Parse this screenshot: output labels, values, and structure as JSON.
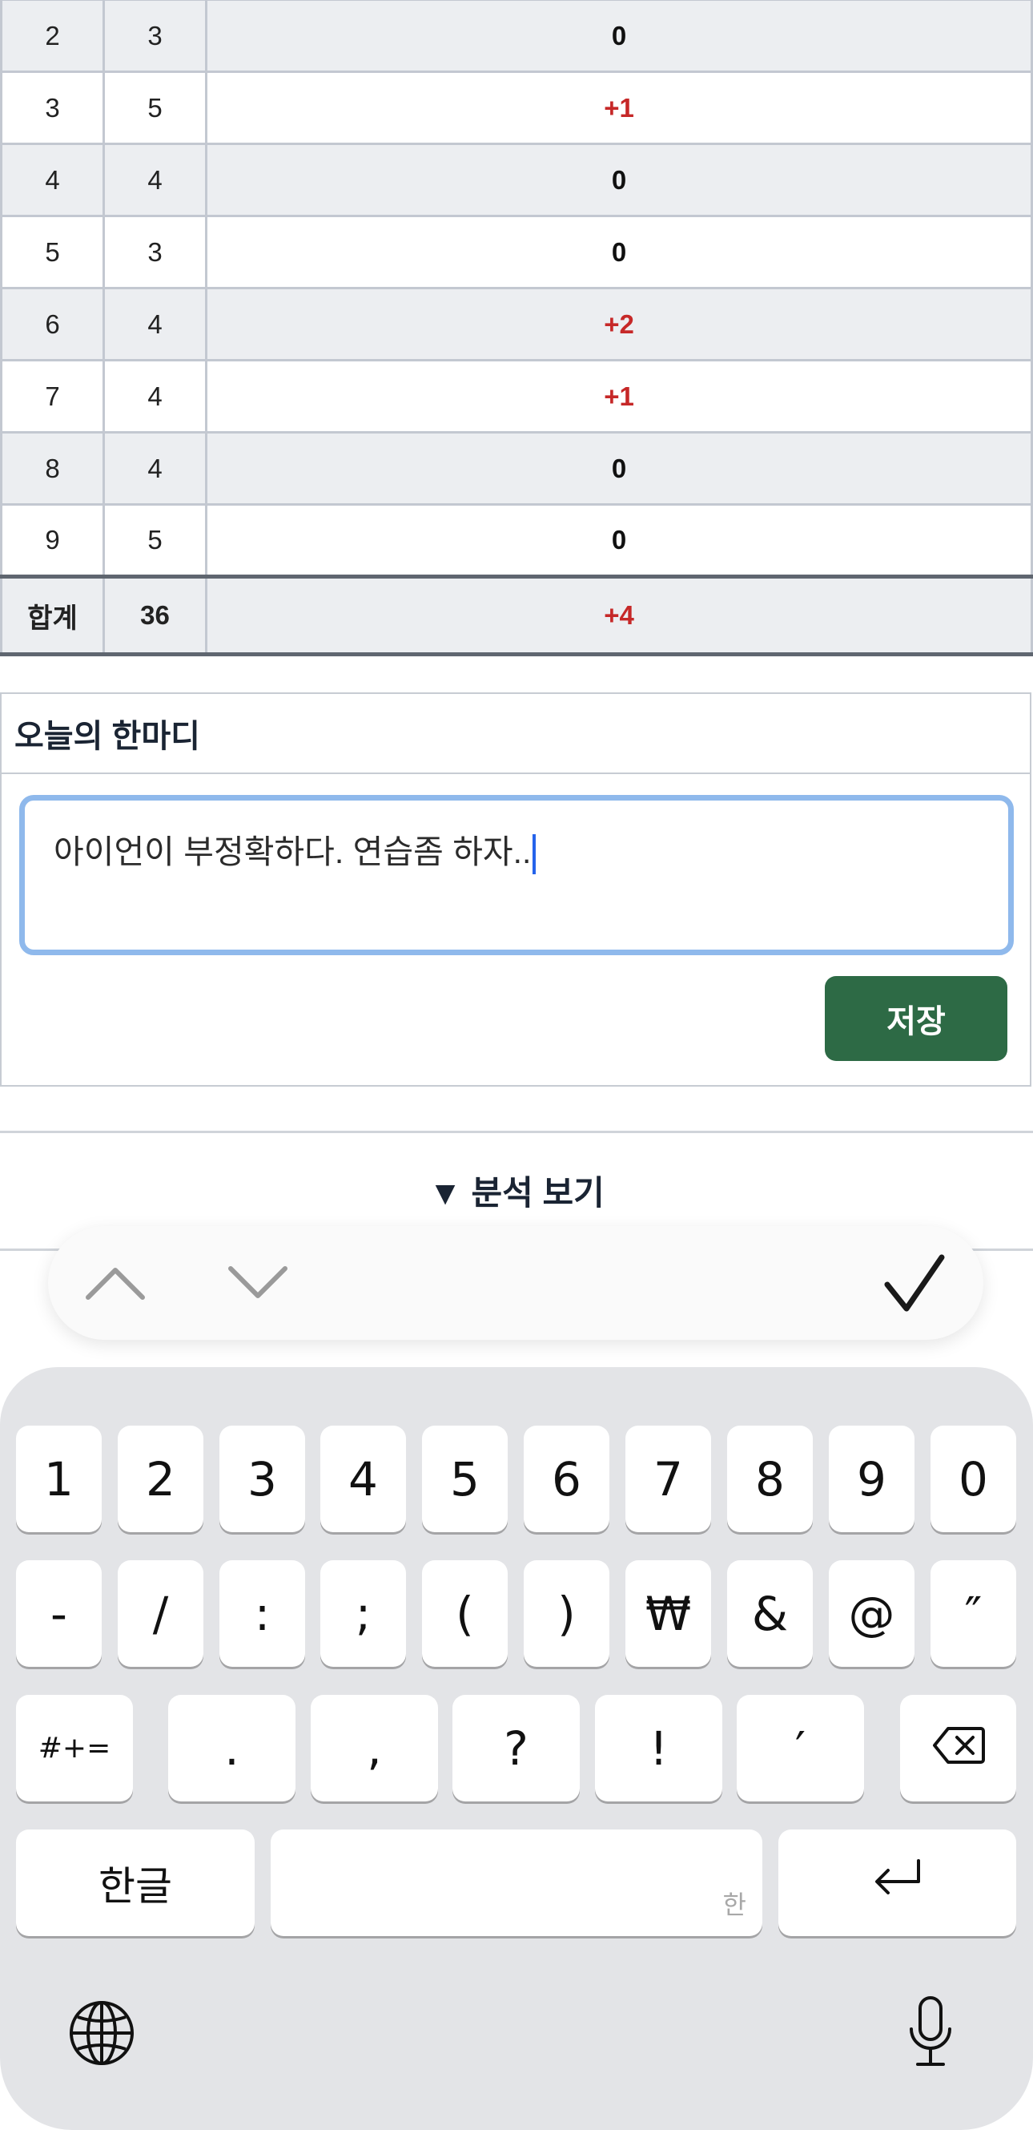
{
  "score_table": {
    "rows": [
      {
        "hole": "2",
        "par": "3",
        "diff": "0"
      },
      {
        "hole": "3",
        "par": "5",
        "diff": "+1"
      },
      {
        "hole": "4",
        "par": "4",
        "diff": "0"
      },
      {
        "hole": "5",
        "par": "3",
        "diff": "0"
      },
      {
        "hole": "6",
        "par": "4",
        "diff": "+2"
      },
      {
        "hole": "7",
        "par": "4",
        "diff": "+1"
      },
      {
        "hole": "8",
        "par": "4",
        "diff": "0"
      },
      {
        "hole": "9",
        "par": "5",
        "diff": "0"
      }
    ],
    "total": {
      "label": "합계",
      "par": "36",
      "diff": "+4"
    }
  },
  "memo": {
    "title": "오늘의 한마디",
    "value": "아이언이 부정확하다. 연습좀 하자..",
    "save_label": "저장"
  },
  "analysis": {
    "arrow": "▼",
    "label": "분석 보기"
  },
  "keyboard": {
    "row1": [
      "1",
      "2",
      "3",
      "4",
      "5",
      "6",
      "7",
      "8",
      "9",
      "0"
    ],
    "row2": [
      "-",
      "/",
      ":",
      ";",
      "(",
      ")",
      "₩",
      "&",
      "@",
      "″"
    ],
    "row3": [
      "#+=",
      ".",
      ",",
      "?",
      "!",
      "′"
    ],
    "hangul_label": "한글",
    "space_hint": "한"
  },
  "colors": {
    "accent_green": "#2d6a45",
    "over_par_red": "#c62828",
    "focus_ring": "#8fb9ec"
  },
  "icons": [
    "chevron-up-icon",
    "chevron-down-icon",
    "checkmark-icon",
    "delete-icon",
    "return-icon",
    "globe-icon",
    "microphone-icon"
  ]
}
